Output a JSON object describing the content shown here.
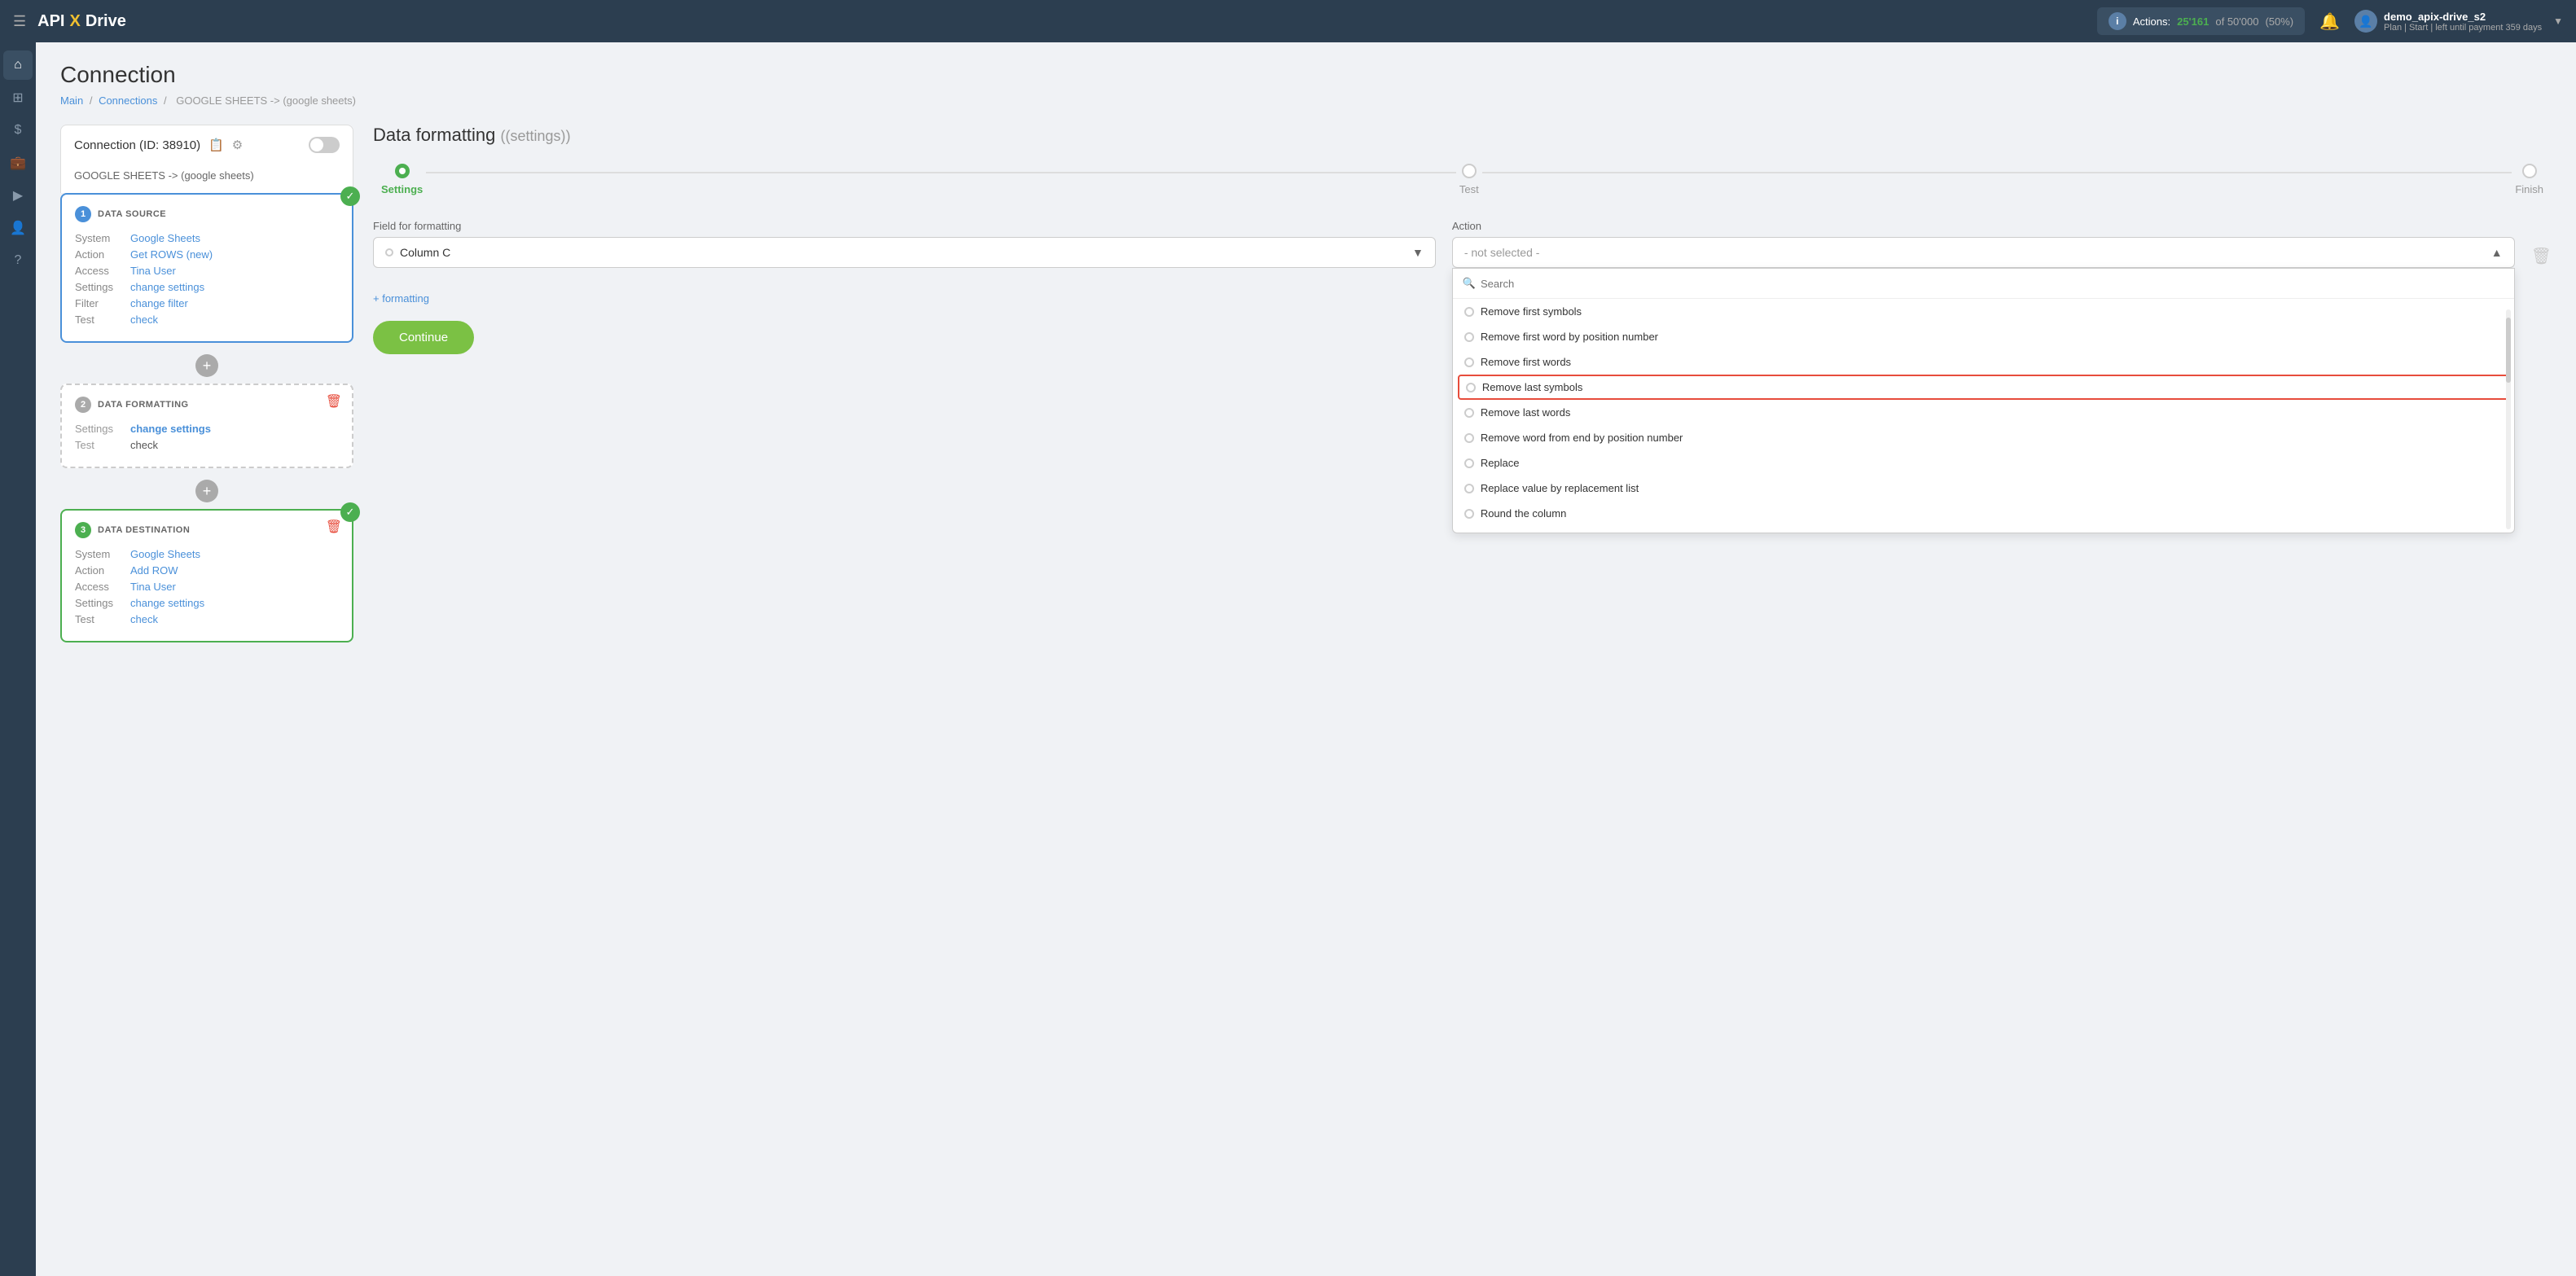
{
  "topnav": {
    "hamburger": "☰",
    "logo_api": "API",
    "logo_x": "X",
    "logo_drive": "Drive",
    "actions_label": "Actions:",
    "actions_count": "25'161",
    "actions_of": "of",
    "actions_total": "50'000",
    "actions_pct": "(50%)",
    "bell": "🔔",
    "user_name": "demo_apix-drive_s2",
    "user_plan": "Plan | Start | left until payment",
    "user_days": "359 days",
    "chevron": "▼"
  },
  "sidebar": {
    "items": [
      {
        "icon": "⌂",
        "name": "home",
        "label": "Home"
      },
      {
        "icon": "⊞",
        "name": "grid",
        "label": "Grid"
      },
      {
        "icon": "$",
        "name": "billing",
        "label": "Billing"
      },
      {
        "icon": "💼",
        "name": "briefcase",
        "label": "Briefcase"
      },
      {
        "icon": "▶",
        "name": "play",
        "label": "Play"
      },
      {
        "icon": "👤",
        "name": "user",
        "label": "User"
      },
      {
        "icon": "?",
        "name": "help",
        "label": "Help"
      }
    ]
  },
  "breadcrumb": {
    "main": "Main",
    "sep1": "/",
    "connections": "Connections",
    "sep2": "/",
    "current": "GOOGLE SHEETS -> (google sheets)"
  },
  "page_title": "Connection",
  "connection_panel": {
    "title": "Connection (ID: 38910)",
    "subtitle": "GOOGLE SHEETS -> (google sheets)"
  },
  "steps": {
    "step1": {
      "number": "1",
      "title": "DATA SOURCE",
      "rows": [
        {
          "label": "System",
          "value": "Google Sheets",
          "is_link": true
        },
        {
          "label": "Action",
          "value": "Get ROWS (new)",
          "is_link": true
        },
        {
          "label": "Access",
          "value": "Tina User",
          "is_link": true
        },
        {
          "label": "Settings",
          "value": "change settings",
          "is_link": true
        },
        {
          "label": "Filter",
          "value": "change filter",
          "is_link": true
        },
        {
          "label": "Test",
          "value": "check",
          "is_link": true
        }
      ]
    },
    "step2": {
      "number": "2",
      "title": "DATA FORMATTING",
      "rows": [
        {
          "label": "Settings",
          "value": "change settings",
          "is_link": true,
          "is_bold": true
        },
        {
          "label": "Test",
          "value": "check",
          "is_link": false
        }
      ]
    },
    "step3": {
      "number": "3",
      "title": "DATA DESTINATION",
      "rows": [
        {
          "label": "System",
          "value": "Google Sheets",
          "is_link": true
        },
        {
          "label": "Action",
          "value": "Add ROW",
          "is_link": true
        },
        {
          "label": "Access",
          "value": "Tina User",
          "is_link": true
        },
        {
          "label": "Settings",
          "value": "change settings",
          "is_link": true
        },
        {
          "label": "Test",
          "value": "check",
          "is_link": true
        }
      ]
    }
  },
  "right_panel": {
    "title": "Data formatting",
    "subtitle": "(settings)",
    "progress": {
      "steps": [
        {
          "label": "Settings",
          "active": true
        },
        {
          "label": "Test",
          "active": false
        },
        {
          "label": "Finish",
          "active": false
        }
      ]
    },
    "form": {
      "field_label": "Field for formatting",
      "field_value": "Column C",
      "action_label": "Action",
      "action_placeholder": "- not selected -",
      "search_placeholder": "Search",
      "options": [
        {
          "label": "Remove first symbols",
          "highlighted": false
        },
        {
          "label": "Remove first word by position number",
          "highlighted": false
        },
        {
          "label": "Remove first words",
          "highlighted": false
        },
        {
          "label": "Remove last symbols",
          "highlighted": true
        },
        {
          "label": "Remove last words",
          "highlighted": false
        },
        {
          "label": "Remove word from end by position number",
          "highlighted": false
        },
        {
          "label": "Replace",
          "highlighted": false
        },
        {
          "label": "Replace value by replacement list",
          "highlighted": false
        },
        {
          "label": "Round the column",
          "highlighted": false
        }
      ],
      "add_formatting_label": "formatting",
      "continue_label": "Continue"
    }
  }
}
